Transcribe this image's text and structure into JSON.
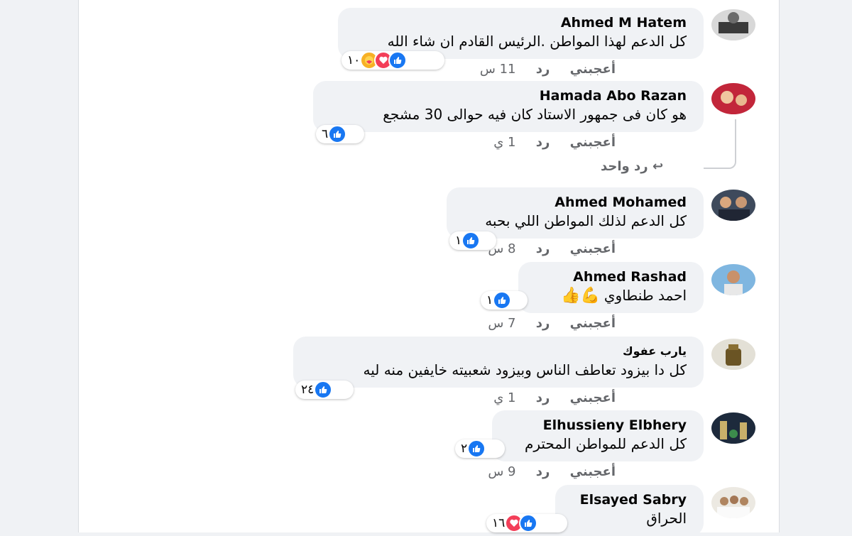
{
  "actions": {
    "like": "أعجبني",
    "reply": "رد"
  },
  "comments": [
    {
      "name": "Ahmed M Hatem",
      "text": "كل الدعم لهذا المواطن .الرئيس القادم ان شاء الله",
      "reactions": "١٠",
      "time": "11 س"
    },
    {
      "name": "Hamada Abo Razan",
      "text": "هو كان فى جمهور الاستاد كان فيه حوالى 30 مشجع",
      "reactions": "٦",
      "time": "1 ي",
      "replies_link": "رد واحد"
    },
    {
      "name": "Ahmed Mohamed",
      "text": "كل الدعم لذلك المواطن اللي بحبه",
      "reactions": "١",
      "time": "8 س"
    },
    {
      "name": "Ahmed Rashad",
      "text": "احمد طنطاوي",
      "emojis": "💪👍",
      "reactions": "١",
      "time": "7 س"
    },
    {
      "name": "يارب عفوك",
      "text": "كل دا بيزود تعاطف الناس وبيزود شعبيته خايفين منه ليه",
      "reactions": "٢٤",
      "time": "1 ي"
    },
    {
      "name": "Elhussieny Elbhery",
      "text": "كل الدعم للمواطن المحترم",
      "reactions": "٢",
      "time": "9 س"
    },
    {
      "name": "Elsayed Sabry",
      "text": "الحراق",
      "reactions": "١٦"
    }
  ],
  "colors": {
    "like": "#1877f2",
    "love": "#f33e58",
    "care": "#f7b125",
    "bubble": "#f0f2f5",
    "meta": "#65676b"
  },
  "icons": {
    "like": "thumbs-up-icon",
    "love": "heart-icon",
    "care": "care-icon",
    "reply_arrow": "reply-arrow-icon"
  }
}
